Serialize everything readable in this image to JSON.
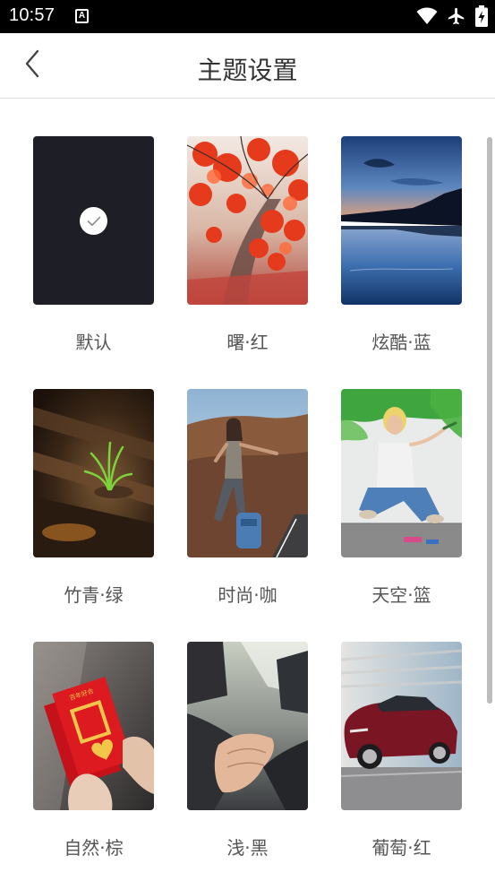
{
  "status_bar": {
    "time": "10:57",
    "notification_letter": "A",
    "icons": [
      "wifi-icon",
      "airplane-mode-icon",
      "battery-charging-icon"
    ]
  },
  "header": {
    "back_icon": "chevron-left-icon",
    "title": "主题设置"
  },
  "themes": [
    {
      "name": "默认",
      "selected": true,
      "bg": "#1e1f26"
    },
    {
      "name": "曙·红",
      "selected": false,
      "bg": "#c8452a"
    },
    {
      "name": "炫酷·蓝",
      "selected": false,
      "bg": "#1e4a86"
    },
    {
      "name": "竹青·绿",
      "selected": false,
      "bg": "#3a2a1c"
    },
    {
      "name": "时尚·咖",
      "selected": false,
      "bg": "#7c5a44"
    },
    {
      "name": "天空·篮",
      "selected": false,
      "bg": "#d8dde0"
    },
    {
      "name": "自然·棕",
      "selected": false,
      "bg": "#5c5552"
    },
    {
      "name": "浅·黑",
      "selected": false,
      "bg": "#3b3b3d"
    },
    {
      "name": "葡萄·红",
      "selected": false,
      "bg": "#7a1524"
    }
  ],
  "colors": {
    "status_bar": "#000000",
    "title_text": "#333333",
    "caption_text": "#555555",
    "divider": "#dcdcdc"
  }
}
